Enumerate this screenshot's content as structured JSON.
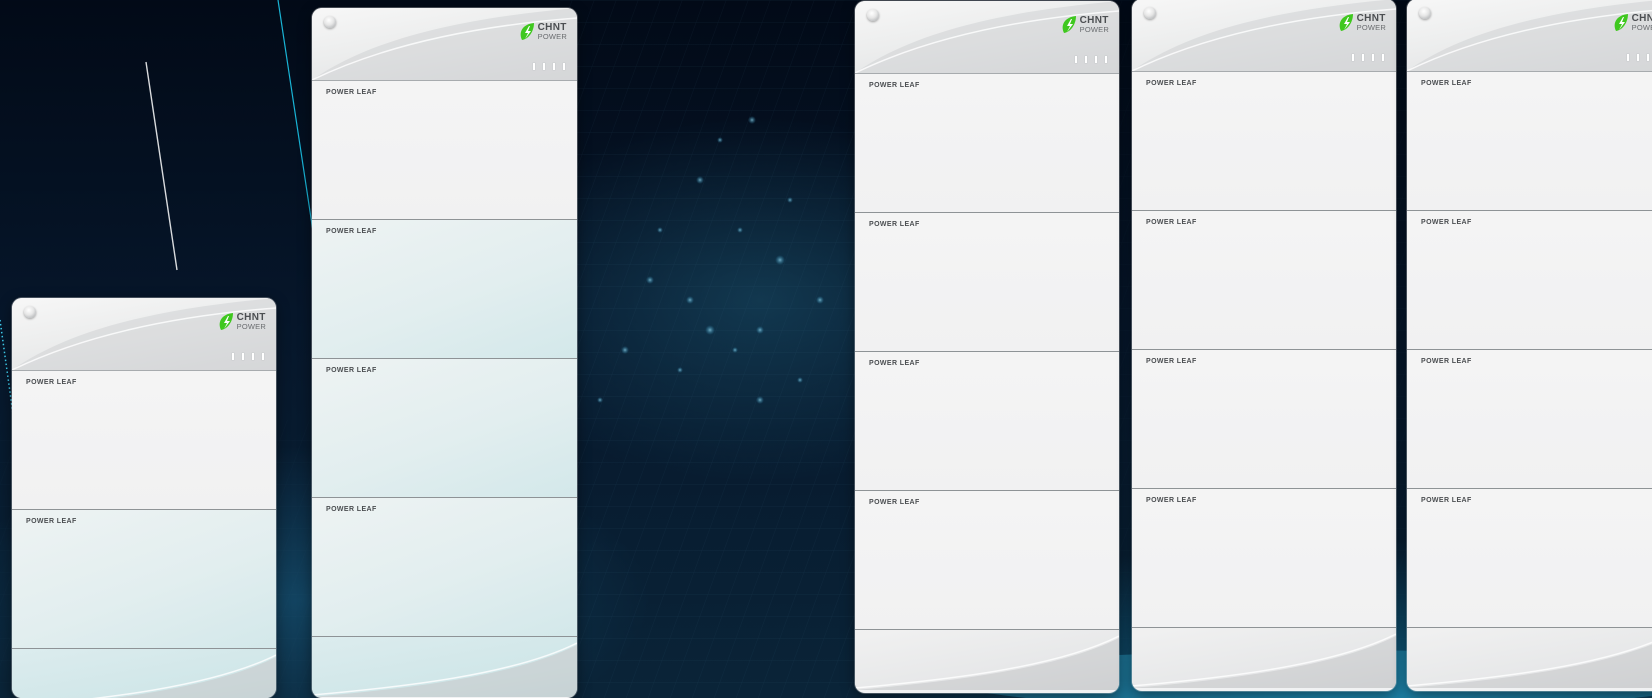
{
  "brand": {
    "name": "CHNT",
    "subtitle": "POWER",
    "accent_color": "#3fc81f",
    "logo_icon": "leaf-lightning-icon"
  },
  "units": [
    {
      "id": "unit-1",
      "modules": [
        "POWER LEAF",
        "POWER LEAF"
      ]
    },
    {
      "id": "unit-2",
      "modules": [
        "POWER LEAF",
        "POWER LEAF",
        "POWER LEAF",
        "POWER LEAF"
      ]
    },
    {
      "id": "unit-3",
      "modules": [
        "POWER LEAF",
        "POWER LEAF",
        "POWER LEAF",
        "POWER LEAF"
      ]
    },
    {
      "id": "unit-4",
      "modules": [
        "POWER LEAF",
        "POWER LEAF",
        "POWER LEAF",
        "POWER LEAF"
      ]
    },
    {
      "id": "unit-5",
      "modules": [
        "POWER LEAF",
        "POWER LEAF",
        "POWER LEAF",
        "POWER LEAF"
      ]
    }
  ],
  "colors": {
    "background_dark": "#020a17",
    "background_glow": "#1496c8",
    "panel": "#f1f2f3"
  }
}
